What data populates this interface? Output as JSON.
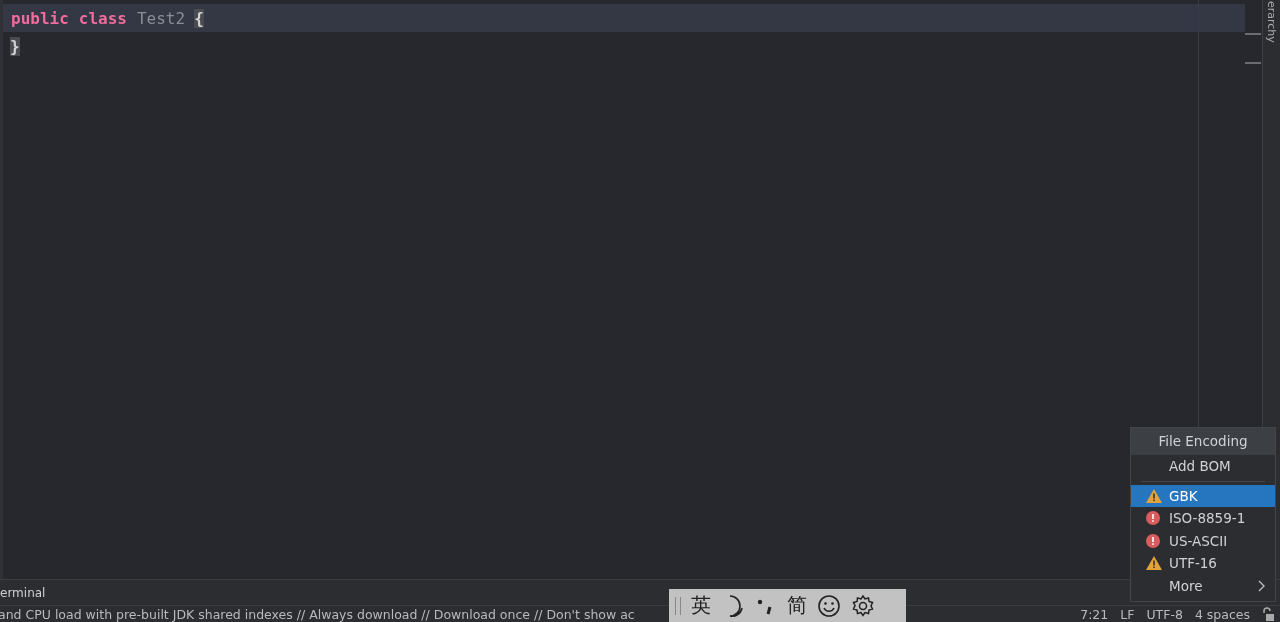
{
  "editor": {
    "lines": [
      {
        "current": true,
        "tokens": [
          {
            "kind": "keyword",
            "text": "public"
          },
          {
            "kind": "keyword",
            "text": "class"
          },
          {
            "kind": "identifier",
            "text": "Test2"
          },
          {
            "kind": "brace",
            "text": "{"
          }
        ]
      },
      {
        "current": false,
        "tokens": [
          {
            "kind": "brace",
            "text": "}"
          }
        ]
      }
    ]
  },
  "right_stripe": {
    "label": "erarchy"
  },
  "tool_window": {
    "title": "erminal"
  },
  "status_bar": {
    "message": "and CPU load with pre-built JDK shared indexes // Always download // Download once // Don't show ac",
    "position": "7:21",
    "line_separator": "LF",
    "encoding": "UTF-8",
    "indent": "4 spaces"
  },
  "ime_toolbar": {
    "language": "英",
    "script": "简"
  },
  "encoding_popup": {
    "title": "File Encoding",
    "items": [
      {
        "kind": "plain",
        "label": "Add BOM",
        "selected": false
      },
      {
        "kind": "separator"
      },
      {
        "kind": "warning",
        "label": "GBK",
        "selected": true
      },
      {
        "kind": "error",
        "label": "ISO-8859-1",
        "selected": false
      },
      {
        "kind": "error",
        "label": "US-ASCII",
        "selected": false
      },
      {
        "kind": "warning",
        "label": "UTF-16",
        "selected": false
      },
      {
        "kind": "submenu",
        "label": "More",
        "selected": false
      }
    ]
  }
}
